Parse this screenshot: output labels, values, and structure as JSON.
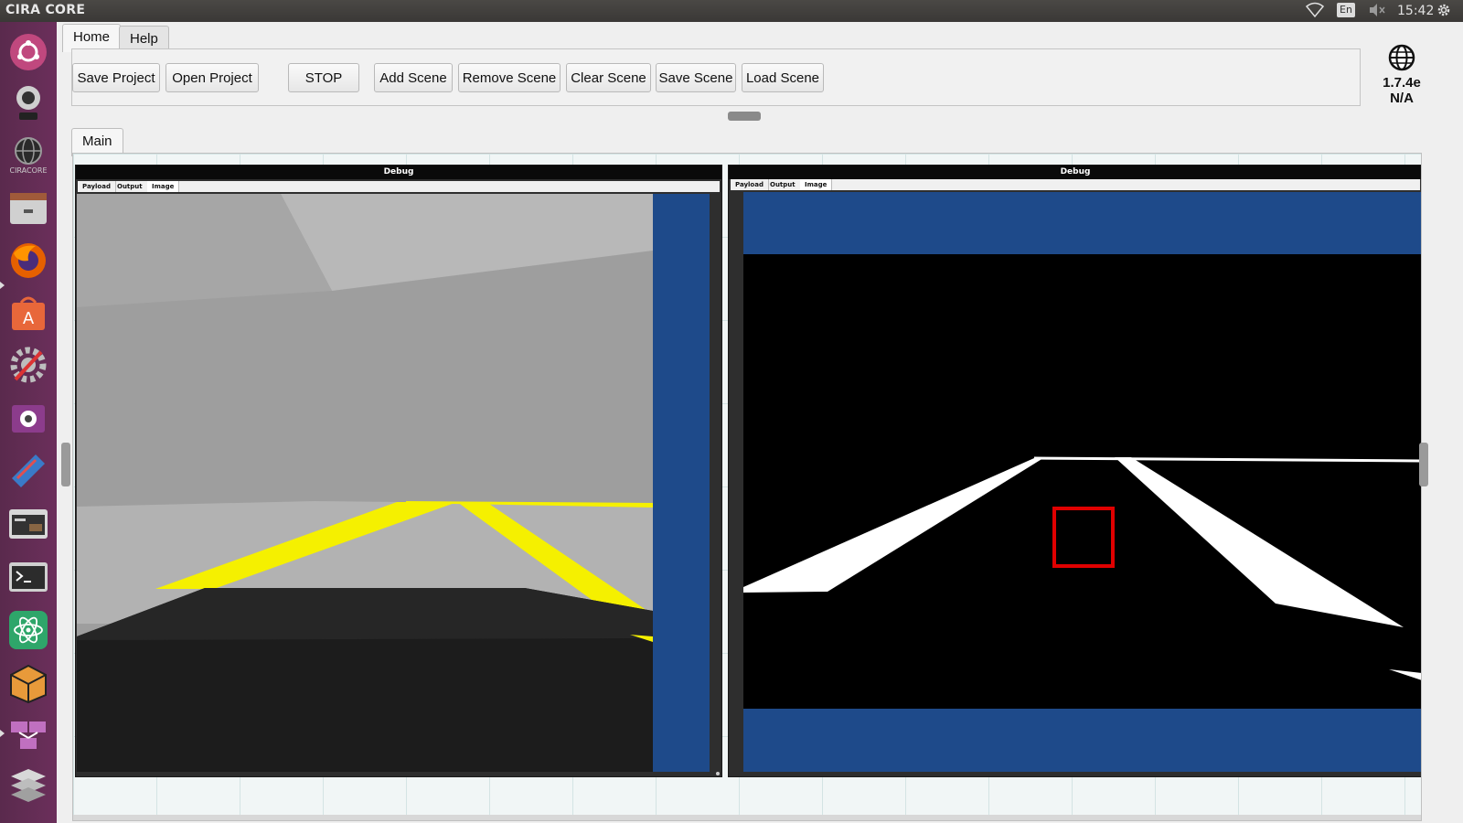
{
  "system_bar": {
    "app_title": "CIRA CORE",
    "language": "En",
    "time": "15:42",
    "icons": [
      "wifi-icon",
      "volume-muted-icon",
      "settings-gear-icon"
    ]
  },
  "launcher": {
    "items": [
      "ubuntu-icon",
      "webcam-icon",
      "ciracore-icon",
      "files-icon",
      "firefox-icon",
      "software-center-icon",
      "settings-tools-icon",
      "media-player-icon",
      "arduino-icon",
      "terminal-window-icon",
      "terminal-icon",
      "atom-icon",
      "package-icon",
      "network-icon",
      "layers-icon"
    ],
    "ciracore_label": "CIRACORE"
  },
  "menu_tabs": {
    "home": "Home",
    "help": "Help"
  },
  "toolbar": {
    "save_project": "Save Project",
    "open_project": "Open Project",
    "stop": "STOP",
    "add_scene": "Add Scene",
    "remove_scene": "Remove Scene",
    "clear_scene": "Clear Scene",
    "save_scene": "Save Scene",
    "load_scene": "Load Scene"
  },
  "version": {
    "number": "1.7.4e",
    "status": "N/A"
  },
  "scene_tab": "Main",
  "nodes": [
    {
      "title": "Debug",
      "tabs": [
        "Payload",
        "Output",
        "Image"
      ],
      "active_tab": "Image"
    },
    {
      "title": "Debug",
      "tabs": [
        "Payload",
        "Output",
        "Image"
      ],
      "active_tab": "Image"
    }
  ],
  "colors": {
    "panel_blue": "#1e4a8a",
    "lane_yellow": "#f5f000",
    "roi_red": "#e00000"
  }
}
